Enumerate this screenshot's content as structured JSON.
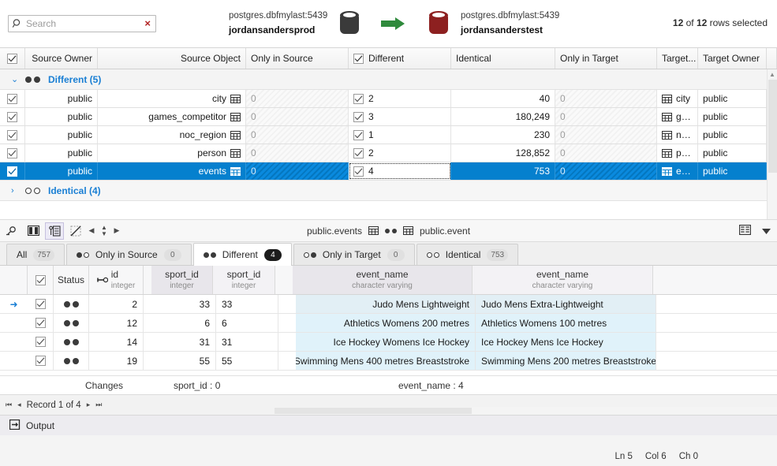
{
  "header": {
    "search": {
      "value": "",
      "placeholder": "Search",
      "clear_label": "×"
    },
    "source": {
      "db": "postgres.dbfmylast:5439",
      "name": "jordansandersprod"
    },
    "target": {
      "db": "postgres.dbfmylast:5439",
      "name": "jordansanderstest"
    },
    "rows_selected_prefix": "12",
    "rows_selected_mid": " of ",
    "rows_selected_count": "12",
    "rows_selected_suffix": " rows selected"
  },
  "top_grid": {
    "columns": [
      "Source Owner",
      "Source Object",
      "Only in Source",
      "Different",
      "Identical",
      "Only in Target",
      "Target...",
      "Target Owner"
    ],
    "groups": [
      {
        "label": "Different (5)",
        "expanded": true,
        "chevron": "⌄"
      },
      {
        "label": "Identical (4)",
        "expanded": false,
        "chevron": "›"
      }
    ],
    "rows": [
      {
        "checked": true,
        "source_owner": "public",
        "source_object": "city",
        "only_in_source": "0",
        "different": "2",
        "identical": "40",
        "only_in_target": "0",
        "target_object": "city",
        "target_owner": "public",
        "selected": false
      },
      {
        "checked": true,
        "source_owner": "public",
        "source_object": "games_competitor",
        "only_in_source": "0",
        "different": "3",
        "identical": "180,249",
        "only_in_target": "0",
        "target_object": "gam...",
        "target_owner": "public",
        "selected": false
      },
      {
        "checked": true,
        "source_owner": "public",
        "source_object": "noc_region",
        "only_in_source": "0",
        "different": "1",
        "identical": "230",
        "only_in_target": "0",
        "target_object": "noc...",
        "target_owner": "public",
        "selected": false
      },
      {
        "checked": true,
        "source_owner": "public",
        "source_object": "person",
        "only_in_source": "0",
        "different": "2",
        "identical": "128,852",
        "only_in_target": "0",
        "target_object": "pers...",
        "target_owner": "public",
        "selected": false
      },
      {
        "checked": true,
        "source_owner": "public",
        "source_object": "events",
        "only_in_source": "0",
        "different": "4",
        "identical": "753",
        "only_in_target": "0",
        "target_object": "event",
        "target_owner": "public",
        "selected": true
      }
    ]
  },
  "mid_toolbar": {
    "source_object": "public.events",
    "target_object": "public.event"
  },
  "tabs": [
    {
      "label": "All",
      "badge": "757",
      "dots": "",
      "active": false
    },
    {
      "label": "Only in Source",
      "badge": "0",
      "dots": "fe",
      "active": false
    },
    {
      "label": "Different",
      "badge": "4",
      "dots": "ff",
      "active": true,
      "badge_dark": true
    },
    {
      "label": "Only in Target",
      "badge": "0",
      "dots": "ef",
      "active": false
    },
    {
      "label": "Identical",
      "badge": "753",
      "dots": "ee",
      "active": false
    }
  ],
  "bottom_grid": {
    "columns": [
      {
        "name": "Status",
        "type": ""
      },
      {
        "name": "id",
        "type": "integer",
        "key": true
      },
      {
        "name": "sport_id",
        "type": "integer"
      },
      {
        "name": "sport_id",
        "type": "integer"
      },
      {
        "name": "event_name",
        "type": "character varying"
      },
      {
        "name": "event_name",
        "type": "character varying"
      }
    ],
    "rows": [
      {
        "checked": true,
        "id": "2",
        "sport_id_src": "33",
        "sport_id_tgt": "33",
        "event_name_src": "Judo Mens Lightweight",
        "event_name_tgt": "Judo Mens Extra-Lightweight",
        "current": true
      },
      {
        "checked": true,
        "id": "12",
        "sport_id_src": "6",
        "sport_id_tgt": "6",
        "event_name_src": "Athletics Womens 200 metres",
        "event_name_tgt": "Athletics Womens 100 metres",
        "current": false
      },
      {
        "checked": true,
        "id": "14",
        "sport_id_src": "31",
        "sport_id_tgt": "31",
        "event_name_src": "Ice Hockey Womens Ice Hockey",
        "event_name_tgt": "Ice Hockey Mens Ice Hockey",
        "current": false
      },
      {
        "checked": true,
        "id": "19",
        "sport_id_src": "55",
        "sport_id_tgt": "55",
        "event_name_src": "Swimming Mens 400 metres Breaststroke",
        "event_name_tgt": "Swimming Mens 200 metres Breaststroke",
        "current": false
      }
    ]
  },
  "changes_bar": {
    "label": "Changes",
    "sport_id": "sport_id : 0",
    "event_name": "event_name : 4"
  },
  "record_nav": {
    "first": "⏮",
    "prev": "◂",
    "text": "Record 1 of 4",
    "next": "▸",
    "last": "⏭"
  },
  "output": {
    "label": "Output"
  },
  "status": {
    "ln": "Ln 5",
    "col": "Col 6",
    "ch": "Ch 0"
  },
  "colors": {
    "selection_blue": "#0580ce",
    "link_blue": "#1a7fd4",
    "source_cylinder": "#3a3a3a",
    "target_cylinder": "#8d2020",
    "arrow_green": "#2f8a3c",
    "diff_highlight": "#e0f2fa"
  }
}
